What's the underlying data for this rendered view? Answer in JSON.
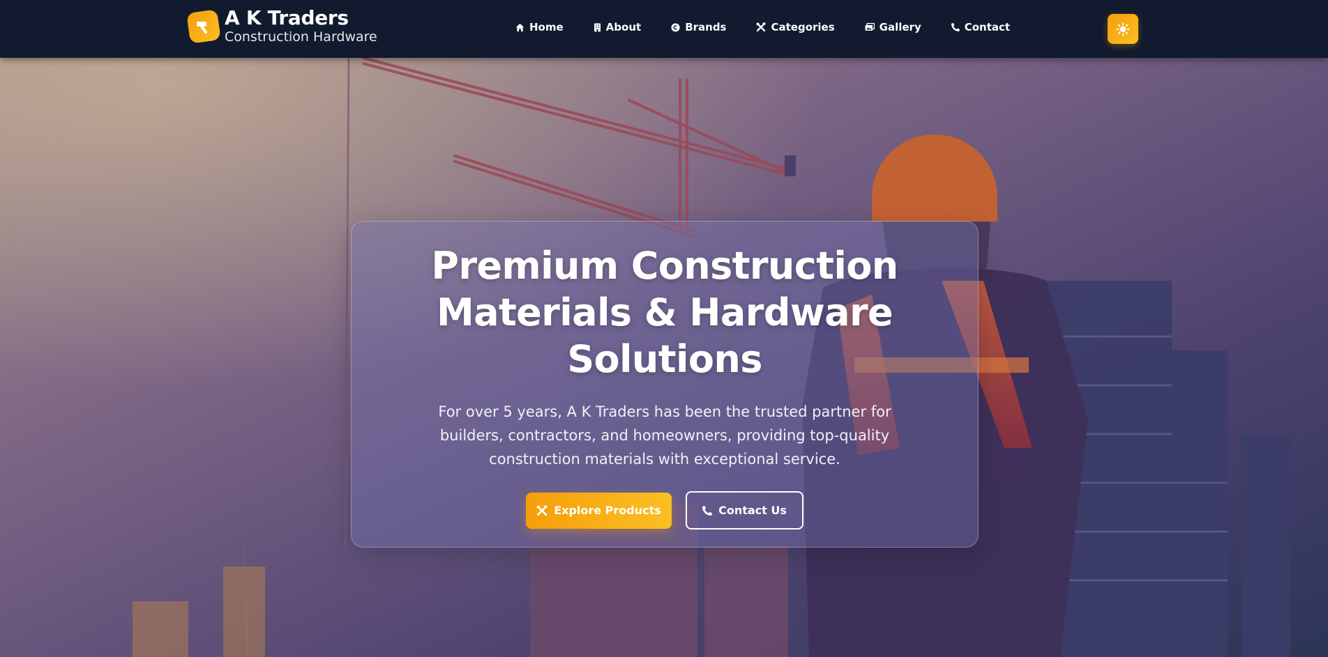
{
  "brand": {
    "name": "A K Traders",
    "subtitle": "Construction Hardware",
    "logo_icon": "hammer-icon"
  },
  "nav": {
    "items": [
      {
        "label": "Home",
        "icon": "home-icon"
      },
      {
        "label": "About",
        "icon": "building-icon"
      },
      {
        "label": "Brands",
        "icon": "copyright-icon"
      },
      {
        "label": "Categories",
        "icon": "tools-icon"
      },
      {
        "label": "Gallery",
        "icon": "images-icon"
      },
      {
        "label": "Contact",
        "icon": "phone-icon"
      }
    ],
    "theme_toggle_icon": "sun-icon"
  },
  "hero": {
    "title": "Premium Construction Materials & Hardware Solutions",
    "description": "For over 5 years, A K Traders has been the trusted partner for builders, contractors, and homeowners, providing top-quality construction materials with exceptional service.",
    "primary_button": {
      "label": "Explore Products",
      "icon": "tools-icon"
    },
    "secondary_button": {
      "label": "Contact Us",
      "icon": "phone-icon"
    },
    "background": "construction-site-photo"
  },
  "colors": {
    "navbar": "#111a2e",
    "accent": "#f59e0b",
    "accent_light": "#fbbf24",
    "text": "#ffffff"
  }
}
